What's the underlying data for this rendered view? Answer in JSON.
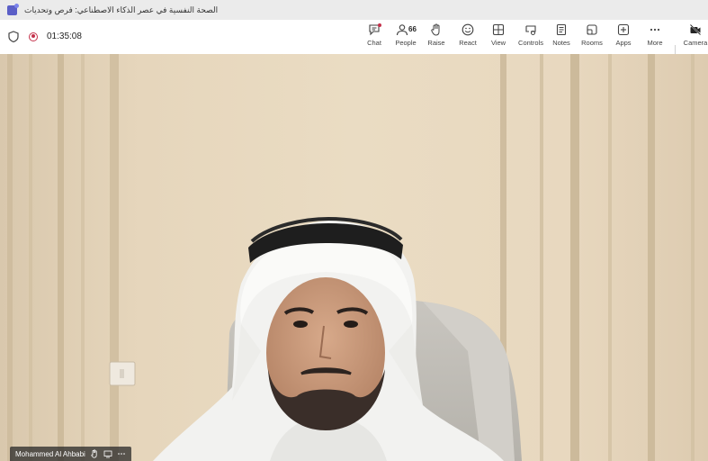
{
  "window": {
    "title": "الصحة النفسية في عصر الذكاء الاصطناعي: فرص وتحديات"
  },
  "status": {
    "timer": "01:35:08"
  },
  "toolbar": {
    "items": [
      {
        "label": "Chat",
        "icon": "chat-icon"
      },
      {
        "label": "People",
        "icon": "people-icon",
        "count": "66"
      },
      {
        "label": "Raise",
        "icon": "hand-icon"
      },
      {
        "label": "React",
        "icon": "smile-icon"
      },
      {
        "label": "View",
        "icon": "grid-icon"
      },
      {
        "label": "Controls",
        "icon": "controls-icon"
      },
      {
        "label": "Notes",
        "icon": "notes-icon"
      },
      {
        "label": "Rooms",
        "icon": "rooms-icon"
      },
      {
        "label": "Apps",
        "icon": "plus-icon"
      },
      {
        "label": "More",
        "icon": "ellipsis-icon"
      },
      {
        "label": "Camera",
        "icon": "camera-off-icon"
      }
    ]
  },
  "video": {
    "participant_name": "Mohammed Al Ahbabi"
  },
  "colors": {
    "accent": "#5b5fc7",
    "recording": "#c4314b",
    "wall": "#e8dac2"
  }
}
